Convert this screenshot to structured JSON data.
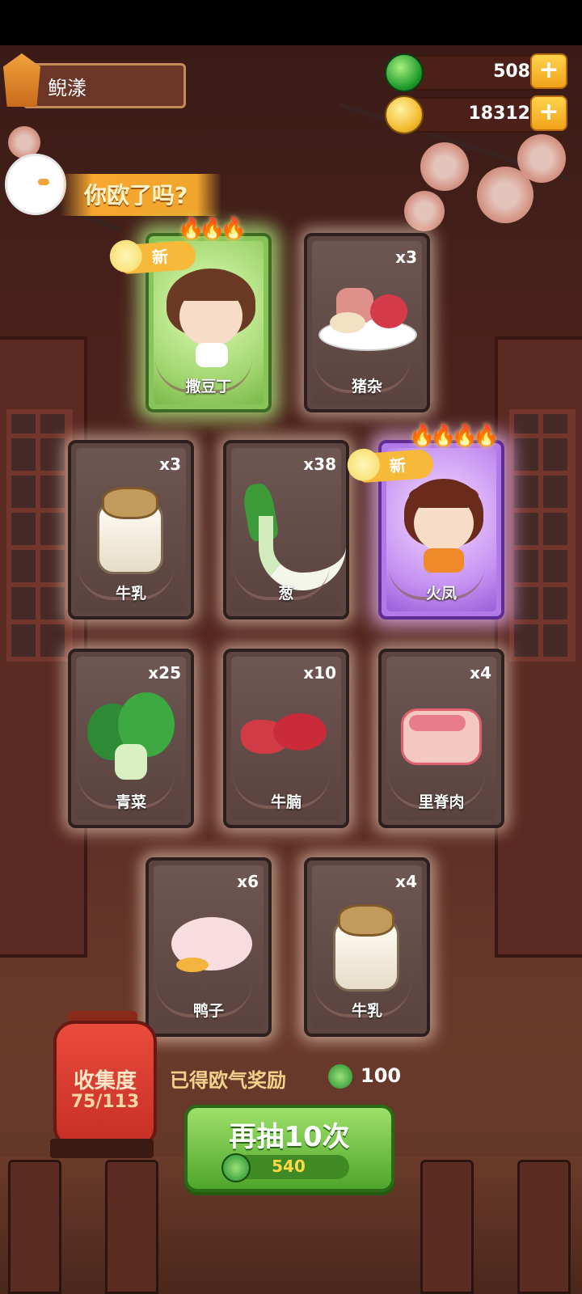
{
  "player": {
    "name": "鲵漾"
  },
  "currency": {
    "jade": {
      "value": "508",
      "icon": "jade-coin-icon"
    },
    "coins": {
      "value": "18312",
      "icon": "gold-coin-icon"
    }
  },
  "banner": {
    "title": "你欧了吗?"
  },
  "cards": [
    {
      "label": "撒豆丁",
      "qty": "",
      "rarity": "green",
      "is_new": true,
      "new_text": "新",
      "stars": 3
    },
    {
      "label": "猪杂",
      "qty": "x3"
    },
    {
      "label": "牛乳",
      "qty": "x3"
    },
    {
      "label": "葱",
      "qty": "x38"
    },
    {
      "label": "火凤",
      "qty": "",
      "rarity": "purple",
      "is_new": true,
      "new_text": "新",
      "stars": 4
    },
    {
      "label": "青菜",
      "qty": "x25"
    },
    {
      "label": "牛腩",
      "qty": "x10"
    },
    {
      "label": "里脊肉",
      "qty": "x4"
    },
    {
      "label": "鸭子",
      "qty": "x6"
    },
    {
      "label": "牛乳",
      "qty": "x4"
    }
  ],
  "collection": {
    "title": "收集度",
    "progress": "75/113"
  },
  "reward": {
    "text": "已得欧气奖励",
    "value": "100"
  },
  "draw_button": {
    "label": "再抽10次",
    "cost": "540"
  },
  "colors": {
    "accent_green": "#4ea52b",
    "accent_gold": "#f0a21a",
    "lantern_red": "#c62e24"
  }
}
